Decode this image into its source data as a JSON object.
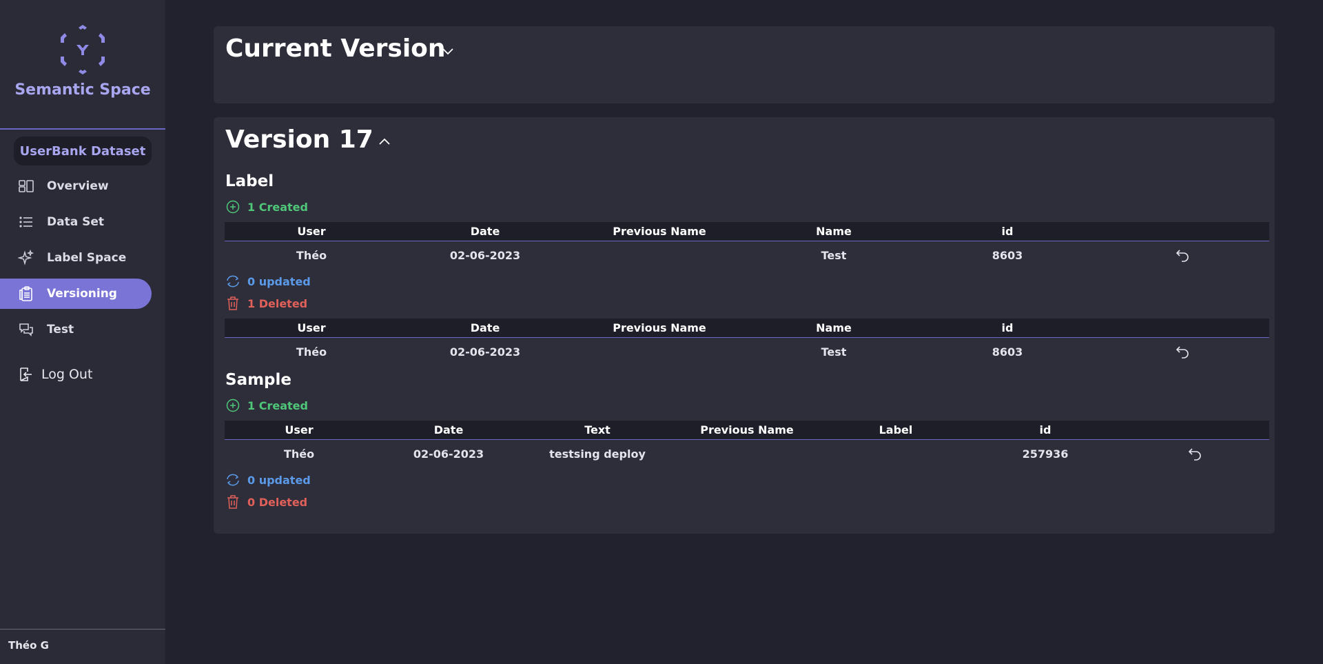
{
  "app": {
    "title": "Semantic Space"
  },
  "sidebar": {
    "dataset_label": "UserBank Dataset",
    "items": [
      {
        "label": "Overview",
        "icon": "layout-icon"
      },
      {
        "label": "Data Set",
        "icon": "list-icon"
      },
      {
        "label": "Label Space",
        "icon": "sparkles-icon"
      },
      {
        "label": "Versioning",
        "icon": "clipboard-icon",
        "active": true
      },
      {
        "label": "Test",
        "icon": "chat-icon"
      }
    ],
    "logout_label": "Log Out",
    "user_name": "Théo G"
  },
  "current_version": {
    "title": "Current Version"
  },
  "version": {
    "title": "Version 17",
    "label_section": {
      "title": "Label",
      "created_label": "1 Created",
      "updated_label": "0 updated",
      "deleted_label": "1 Deleted",
      "columns": [
        "User",
        "Date",
        "Previous Name",
        "Name",
        "id"
      ],
      "created_rows": [
        {
          "user": "Théo",
          "date": "02-06-2023",
          "previous_name": "",
          "name": "Test",
          "id": "8603"
        }
      ],
      "deleted_rows": [
        {
          "user": "Théo",
          "date": "02-06-2023",
          "previous_name": "",
          "name": "Test",
          "id": "8603"
        }
      ]
    },
    "sample_section": {
      "title": "Sample",
      "created_label": "1 Created",
      "updated_label": "0 updated",
      "deleted_label": "0 Deleted",
      "columns": [
        "User",
        "Date",
        "Text",
        "Previous Name",
        "Label",
        "id"
      ],
      "created_rows": [
        {
          "user": "Théo",
          "date": "02-06-2023",
          "text": "testsing deploy",
          "previous_name": "",
          "label": "",
          "id": "257936"
        }
      ]
    }
  },
  "colors": {
    "accent": "#7a74d6",
    "created": "#4fc779",
    "updated": "#5b9ae8",
    "deleted": "#e2605a"
  }
}
